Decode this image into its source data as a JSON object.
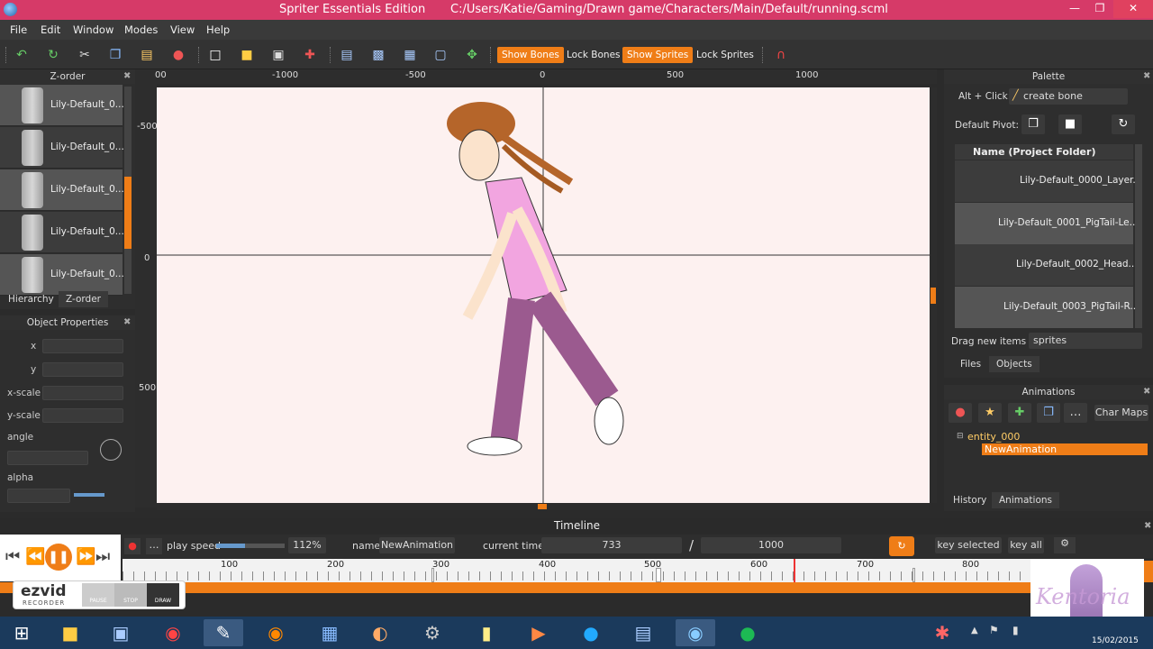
{
  "window": {
    "title": "Spriter Essentials Edition",
    "file_path": "C:/Users/Katie/Gaming/Drawn game/Characters/Main/Default/running.scml",
    "title_color": "#d63a68"
  },
  "menu": [
    "File",
    "Edit",
    "Window",
    "Modes",
    "View",
    "Help"
  ],
  "toolbar": {
    "show_bones": "Show Bones",
    "lock_bones": "Lock Bones",
    "show_sprites": "Show Sprites",
    "lock_sprites": "Lock Sprites",
    "accent": "#ef7d17"
  },
  "zorder": {
    "title": "Z-order",
    "items": [
      "Lily-Default_0...",
      "Lily-Default_0...",
      "Lily-Default_0...",
      "Lily-Default_0...",
      "Lily-Default_0..."
    ],
    "tabs": [
      "Hierarchy",
      "Z-order"
    ]
  },
  "object_properties": {
    "title": "Object Properties",
    "labels": [
      "x",
      "y",
      "x-scale",
      "y-scale",
      "angle",
      "alpha"
    ]
  },
  "rulers": {
    "top": [
      "00",
      "-1000",
      "-500",
      "0",
      "500",
      "1000"
    ],
    "left": [
      "-500",
      "0",
      "500"
    ]
  },
  "palette": {
    "title": "Palette",
    "alt_click": "Alt + Click:",
    "create_bone": "create bone",
    "default_pivot": "Default Pivot:",
    "column_header": "Name    (Project Folder)",
    "items": [
      "Lily-Default_0000_Layer...",
      "Lily-Default_0001_PigTail-Le...",
      "Lily-Default_0002_Head...",
      "Lily-Default_0003_PigTail-R..."
    ],
    "drag_label": "Drag new items as",
    "drag_value": "sprites",
    "tabs": [
      "Files",
      "Objects"
    ]
  },
  "animations": {
    "title": "Animations",
    "char_maps": "Char Maps",
    "entity": "entity_000",
    "animation": "NewAnimation",
    "tabs": [
      "History",
      "Animations"
    ]
  },
  "timeline": {
    "title": "Timeline",
    "play_speed_label": "play speed",
    "play_speed": "112%",
    "name_label": "name",
    "name_value": "NewAnimation",
    "current_time_label": "current time:",
    "current_time": "733",
    "slash": "/",
    "total_time": "1000",
    "key_selected": "key selected",
    "key_all": "key all",
    "ticks": [
      "100",
      "200",
      "300",
      "400",
      "500",
      "600",
      "700",
      "800"
    ]
  },
  "recorder": {
    "brand": "ezvid",
    "sub": "RECORDER",
    "pause": "PAUSE",
    "stop": "STOP",
    "draw": "DRAW"
  },
  "watermark": "Kentoria",
  "clock_date": "15/02/2015"
}
